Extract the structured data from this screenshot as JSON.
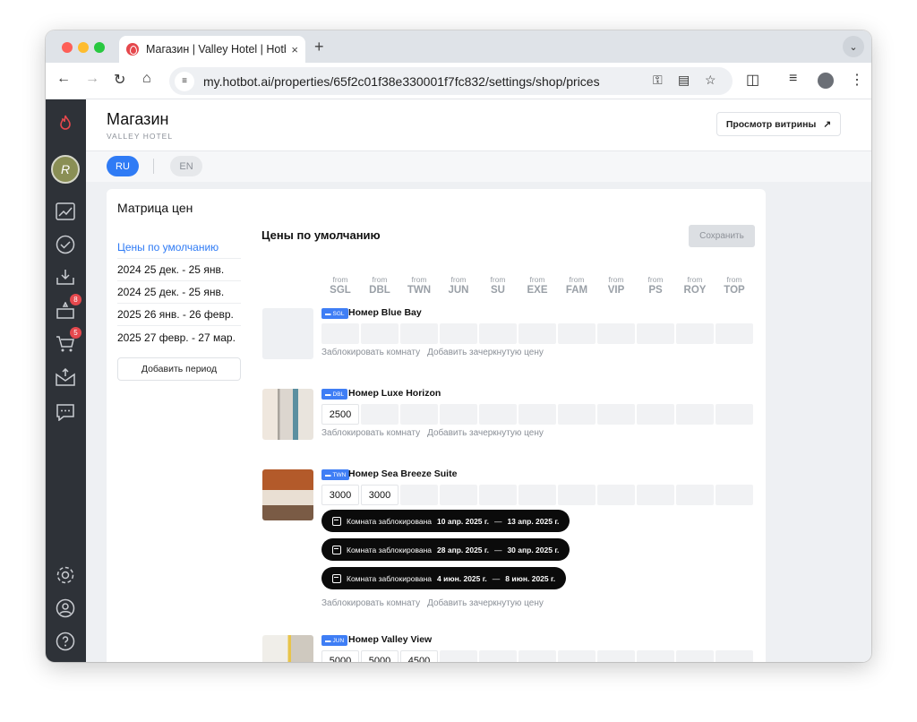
{
  "browser": {
    "tab_title": "Магазин | Valley Hotel | Hotbot",
    "url": "my.hotbot.ai/properties/65f2c01f38e330001f7fc832/settings/shop/prices",
    "new_tab": "+",
    "close": "×"
  },
  "sidebar": {
    "avatar_letter": "R",
    "reviews_badge": "8",
    "cart_badge": "5"
  },
  "header": {
    "title": "Магазин",
    "subtitle": "VALLEY HOTEL",
    "storefront_button": "Просмотр витрины",
    "storefront_arrow": "↗"
  },
  "langs": {
    "ru": "RU",
    "en": "EN"
  },
  "card": {
    "title": "Матрица цен",
    "section_title": "Цены по умолчанию",
    "save_button": "Сохранить",
    "add_period": "Добавить период"
  },
  "periods": [
    "Цены по умолчанию",
    "2024 25 дек. - 25 янв.",
    "2024 25 дек. - 25 янв.",
    "2025 26 янв. - 26 февр.",
    "2025 27 февр. - 27 мар."
  ],
  "columns": [
    {
      "from": "from",
      "code": "SGL"
    },
    {
      "from": "from",
      "code": "DBL"
    },
    {
      "from": "from",
      "code": "TWN"
    },
    {
      "from": "from",
      "code": "JUN"
    },
    {
      "from": "from",
      "code": "SU"
    },
    {
      "from": "from",
      "code": "EXE"
    },
    {
      "from": "from",
      "code": "FAM"
    },
    {
      "from": "from",
      "code": "VIP"
    },
    {
      "from": "from",
      "code": "PS"
    },
    {
      "from": "from",
      "code": "ROY"
    },
    {
      "from": "from",
      "code": "TOP"
    }
  ],
  "links": {
    "block": "Заблокировать комнату",
    "strike": "Добавить зачеркнутую цену"
  },
  "blocked_label": "Комната заблокирована",
  "rooms": [
    {
      "code": "SGL",
      "name": "Номер Blue Bay",
      "prices": [
        "",
        "",
        "",
        "",
        "",
        "",
        "",
        "",
        "",
        "",
        ""
      ],
      "blocks": []
    },
    {
      "code": "DBL",
      "name": "Номер Luxe Horizon",
      "prices": [
        "2500",
        "",
        "",
        "",
        "",
        "",
        "",
        "",
        "",
        "",
        ""
      ],
      "blocks": []
    },
    {
      "code": "TWN",
      "name": "Номер Sea Breeze Suite",
      "prices": [
        "3000",
        "3000",
        "",
        "",
        "",
        "",
        "",
        "",
        "",
        "",
        ""
      ],
      "blocks": [
        {
          "from": "10 апр. 2025 г.",
          "to": "13 апр. 2025 г."
        },
        {
          "from": "28 апр. 2025 г.",
          "to": "30 апр. 2025 г."
        },
        {
          "from": "4 июн. 2025 г.",
          "to": "8 июн. 2025 г."
        }
      ]
    },
    {
      "code": "JUN",
      "name": "Номер Valley View",
      "prices": [
        "5000",
        "5000",
        "4500",
        "",
        "",
        "",
        "",
        "",
        "",
        "",
        ""
      ],
      "blocks": []
    }
  ]
}
